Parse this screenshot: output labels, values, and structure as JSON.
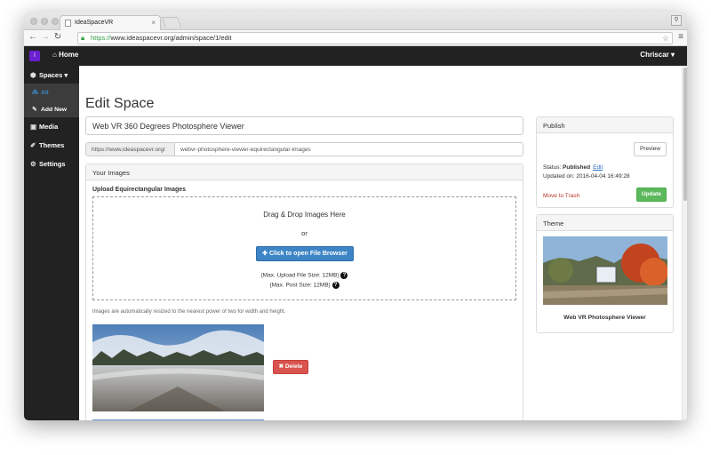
{
  "browser": {
    "tab_title": "IdeaSpaceVR",
    "url_scheme": "https://",
    "url_rest": "www.ideaspacevr.org/admin/space/1/edit"
  },
  "topnav": {
    "brand_icon": "ideaspace-logo",
    "home_label": "Home",
    "user_label": "Chriscar ▾"
  },
  "sidebar": {
    "items": [
      {
        "label": "Spaces ▾",
        "icon": "cube-icon"
      },
      {
        "label": "All",
        "icon": "cubes-icon"
      },
      {
        "label": "Add New",
        "icon": "pencil-icon"
      },
      {
        "label": "Media",
        "icon": "image-icon"
      },
      {
        "label": "Themes",
        "icon": "brush-icon"
      },
      {
        "label": "Settings",
        "icon": "gears-icon"
      }
    ]
  },
  "main": {
    "page_title": "Edit Space",
    "title_value": "Web VR 360 Degrees Photosphere Viewer",
    "slug_prefix": "https://www.ideaspacevr.org/",
    "slug_value": "webvr-photosphere-viewer-equirectangular-images",
    "images_panel": {
      "heading": "Your Images",
      "upload_label": "Upload Equirectangular Images",
      "drop_text": "Drag & Drop Images Here",
      "or_text": "or",
      "browse_button": "✚ Click to open File Browser",
      "max_upload": "(Max. Upload File Size: 12MB)",
      "max_post": "(Max. Post Size: 12MB)",
      "resize_note": "Images are automatically resized to the nearest power of two for width and height.",
      "delete_button": "✖ Delete"
    }
  },
  "publish": {
    "heading": "Publish",
    "preview_button": "Preview",
    "status_label": "Status:",
    "status_value": "Published",
    "edit_link": "Edit",
    "updated_label": "Updated on:",
    "updated_value": "2016-04-04 16:49:28",
    "trash_link": "Move to Trash",
    "update_button": "Update"
  },
  "theme": {
    "heading": "Theme",
    "name": "Web VR Photosphere Viewer"
  },
  "colors": {
    "nav_bg": "#222222",
    "accent_blue": "#3d85c6",
    "brand_purple": "#6a1fd1",
    "delete_red": "#d9534f",
    "update_green": "#5cb85c"
  }
}
